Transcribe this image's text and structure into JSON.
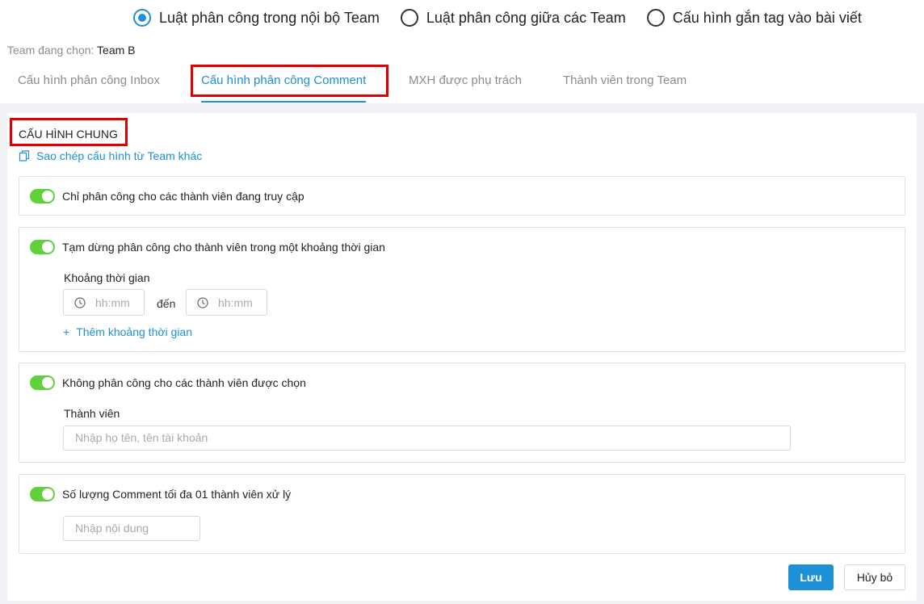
{
  "rule_options": [
    {
      "label": "Luật phân công trong nội bộ Team",
      "checked": true
    },
    {
      "label": "Luật phân công giữa các Team",
      "checked": false
    },
    {
      "label": "Cấu hình gắn tag vào bài viết",
      "checked": false
    }
  ],
  "team": {
    "label": "Team đang chọn:",
    "value": "Team B"
  },
  "tabs": [
    {
      "label": "Cấu hình phân công Inbox",
      "active": false
    },
    {
      "label": "Cấu hình phân công Comment",
      "active": true
    },
    {
      "label": "MXH được phụ trách",
      "active": false
    },
    {
      "label": "Thành viên trong Team",
      "active": false
    }
  ],
  "general": {
    "title": "CẤU HÌNH CHUNG",
    "copy_link": "Sao chép cấu hình từ Team khác"
  },
  "cards": {
    "online_only": {
      "title": "Chỉ phân công cho các thành viên đang truy cập",
      "enabled": true
    },
    "pause": {
      "title": "Tạm dừng phân công cho thành viên trong một khoảng thời gian",
      "enabled": true,
      "field_label": "Khoảng thời gian",
      "from_placeholder": "hh:mm",
      "to_text": "đến",
      "to_placeholder": "hh:mm",
      "add_link": "Thêm khoảng thời gian"
    },
    "exclude": {
      "title": "Không phân công cho các thành viên được chọn",
      "enabled": true,
      "field_label": "Thành viên",
      "placeholder": "Nhập họ tên, tên tài khoản"
    },
    "max_comments": {
      "title": "Số lượng Comment tối đa 01 thành viên xử lý",
      "enabled": true,
      "placeholder": "Nhập nội dung"
    }
  },
  "buttons": {
    "save": "Lưu",
    "cancel": "Hủy bỏ"
  },
  "colors": {
    "accent": "#1e90d6",
    "toggle_on": "#5fd13b",
    "highlight": "#e00000"
  },
  "icons": {
    "copy": "copy-icon",
    "clock": "clock-icon",
    "plus": "plus-icon"
  }
}
